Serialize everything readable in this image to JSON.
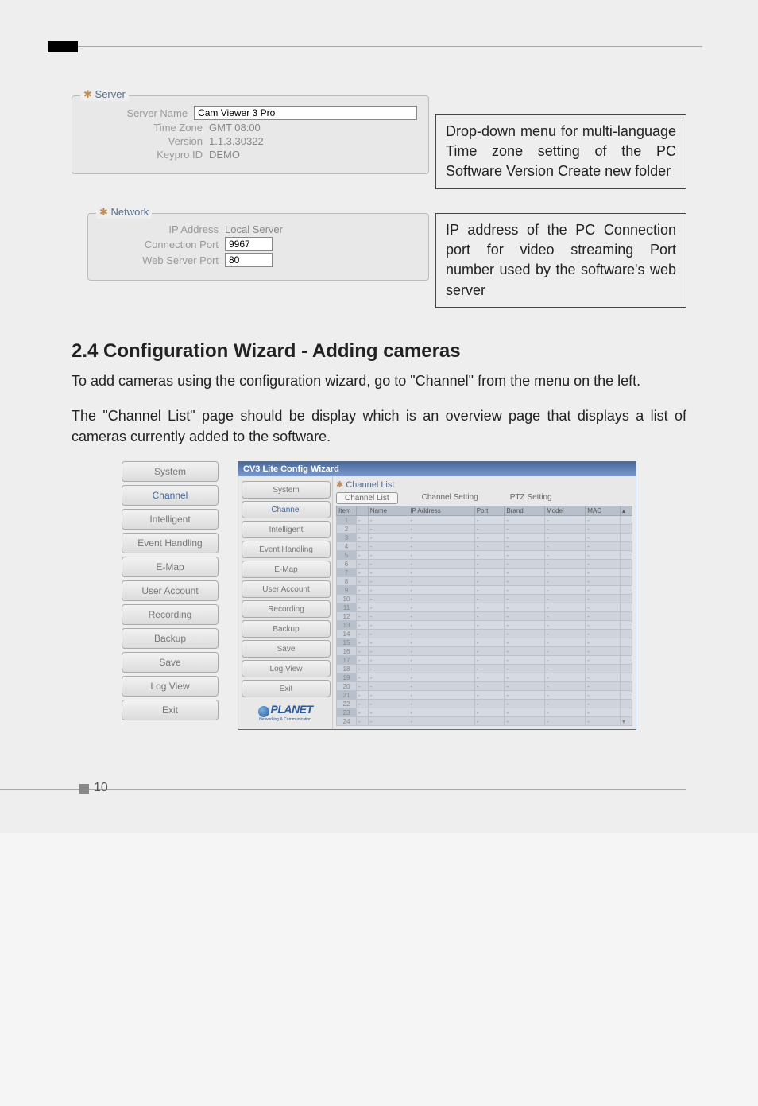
{
  "server_panel": {
    "title": "Server",
    "rows": {
      "server_name_label": "Server Name",
      "server_name_value": "Cam Viewer 3 Pro",
      "time_zone_label": "Time Zone",
      "time_zone_value": "GMT 08:00",
      "version_label": "Version",
      "version_value": "1.1.3.30322",
      "keypro_label": "Keypro ID",
      "keypro_value": "DEMO"
    },
    "annotation": "Drop-down menu for multi-language Time zone setting of the PC Software Version Create new folder"
  },
  "network_panel": {
    "title": "Network",
    "rows": {
      "ip_label": "IP Address",
      "ip_value": "Local Server",
      "conn_label": "Connection Port",
      "conn_value": "9967",
      "web_label": "Web Server Port",
      "web_value": "80"
    },
    "annotation": "IP address of the PC Connection port for video streaming Port number used by the software's web server"
  },
  "section": {
    "heading": "2.4  Configuration Wizard - Adding cameras",
    "para1": "To add cameras using the configuration wizard, go to \"Channel\" from the menu on the left.",
    "para2": "The \"Channel List\" page should be display which is an overview page that displays a list of cameras currently added to the software."
  },
  "left_menu": [
    "System",
    "Channel",
    "Intelligent",
    "Event Handling",
    "E-Map",
    "User Account",
    "Recording",
    "Backup",
    "Save",
    "Log View",
    "Exit"
  ],
  "wizard": {
    "window_title": "CV3 Lite Config Wizard",
    "menu": [
      "System",
      "Channel",
      "Intelligent",
      "Event Handling",
      "E-Map",
      "User Account",
      "Recording",
      "Backup",
      "Save",
      "Log View",
      "Exit"
    ],
    "logo": "PLANET",
    "logo_sub": "Networking & Communication",
    "cl_title": "Channel List",
    "tabs": [
      "Channel List",
      "Channel Setting",
      "PTZ Setting"
    ],
    "headers": [
      "Item",
      "",
      "Name",
      "IP Address",
      "Port",
      "Brand",
      "Model",
      "MAC"
    ],
    "row_count": 24
  },
  "page_number": "10"
}
